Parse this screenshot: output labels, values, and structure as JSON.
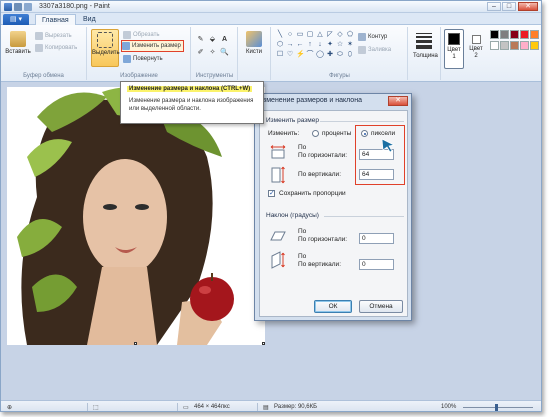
{
  "window": {
    "title": "3307a3180.png - Paint",
    "minimize": "–",
    "maximize": "□",
    "close": "✕"
  },
  "tabs": {
    "file_glyph": "▤ ▾",
    "items": [
      "Главная",
      "Вид"
    ]
  },
  "ribbon": {
    "clipboard": {
      "label": "Буфер обмена",
      "paste": "Вставить",
      "cut": "Вырезать",
      "copy": "Копировать"
    },
    "image": {
      "label": "Изображение",
      "select": "Выделить",
      "crop": "Обрезать",
      "resize": "Изменить размер",
      "rotate": "Повернуть"
    },
    "tools": {
      "label": "Инструменты",
      "glyphs": [
        "✎",
        "⬙",
        "A",
        "✐",
        "✧",
        "🔍"
      ]
    },
    "brushes": {
      "label": "Кисти"
    },
    "shapes": {
      "label": "Фигуры",
      "glyphs": [
        "╲",
        "○",
        "▭",
        "▢",
        "△",
        "◸",
        "◇",
        "⬠",
        "⬡",
        "→",
        "←",
        "↑",
        "↓",
        "✦",
        "☆",
        "✶",
        "☐",
        "♡",
        "⚡",
        "⌒",
        "◯",
        "✚",
        "⬭",
        "⬯"
      ],
      "outline": "Контур",
      "fill": "Заливка"
    },
    "thickness": {
      "label": "Толщина"
    },
    "colors": {
      "color1": "Цвет 1",
      "color2": "Цвет 2",
      "color1_value": "#000000",
      "color2_value": "#ffffff",
      "palette": [
        "#000000",
        "#7f7f7f",
        "#880015",
        "#ed1c24",
        "#ff7f27",
        "#ffffff",
        "#c3c3c3",
        "#b97a57",
        "#ffaec9",
        "#ffc90e"
      ]
    }
  },
  "tooltip": {
    "title": "Изменение размера и наклона (CTRL+W)",
    "body": "Изменение размера и наклона изображения или выделенной области."
  },
  "dialog": {
    "title": "Изменение размеров и наклона",
    "close": "✕",
    "resize": {
      "heading": "Изменить размер",
      "by_label": "Изменить:",
      "percent_label": "проценты",
      "pixels_label": "пиксели",
      "horizontal_label": "По горизонтали:",
      "vertical_label": "По вертикали:",
      "horizontal_value": "64",
      "vertical_value": "64",
      "keep_ratio_label": "Сохранить пропорции"
    },
    "skew": {
      "heading": "Наклон (градусы)",
      "horizontal_label": "По горизонтали:",
      "vertical_label": "По вертикали:",
      "horizontal_value": "0",
      "vertical_value": "0"
    },
    "ok": "ОК",
    "cancel": "Отмена"
  },
  "statusbar": {
    "dimensions": "464 × 464пкс",
    "size": "Размер: 90,6КБ",
    "zoom": "100%"
  }
}
